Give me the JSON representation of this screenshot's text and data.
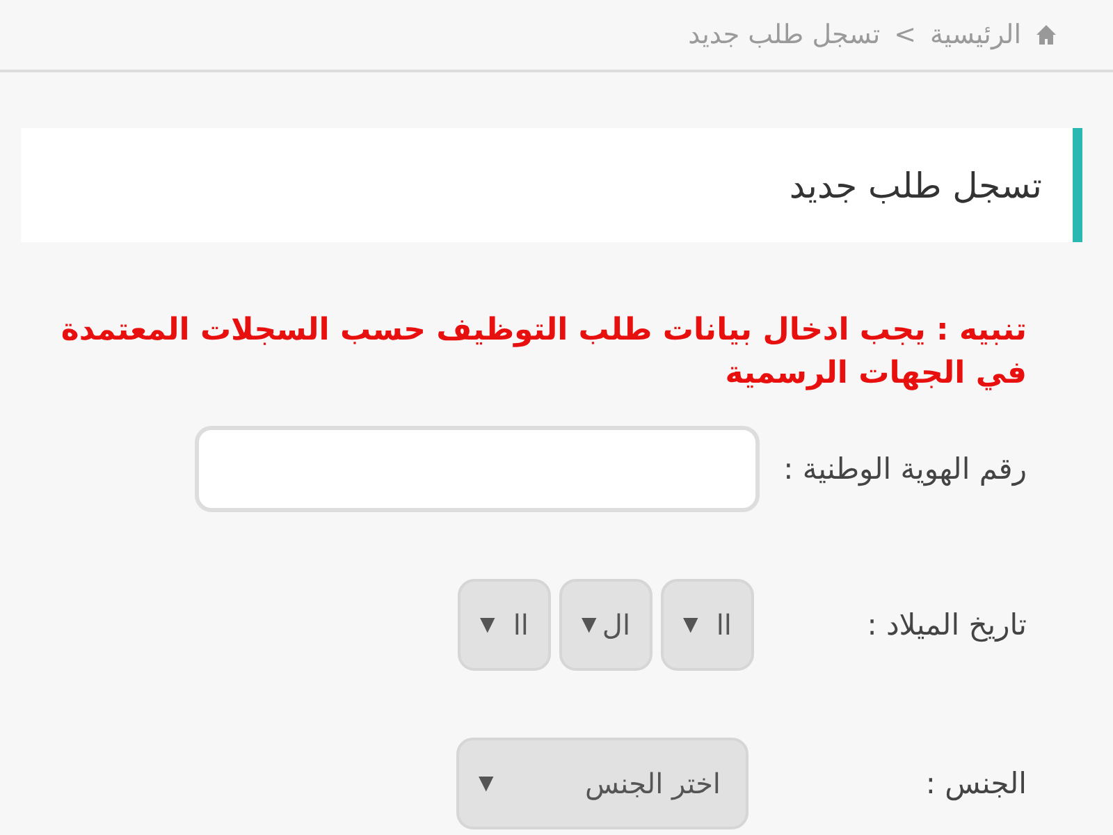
{
  "breadcrumb": {
    "home": "الرئيسية",
    "separator": ">",
    "current": "تسجل طلب جديد"
  },
  "page_title": "تسجل طلب جديد",
  "warning": "تنبيه : يجب ادخال بيانات طلب التوظيف حسب السجلات المعتمدة في الجهات الرسمية",
  "fields": [
    {
      "kind": "text",
      "label": "رقم الهوية الوطنية :"
    },
    {
      "kind": "date",
      "label": "تاريخ الميلاد :",
      "selects": [
        {
          "value": "اا",
          "arrow": "▼"
        },
        {
          "value": "ال",
          "arrow": "▼"
        },
        {
          "value": "اا",
          "arrow": "▼"
        }
      ]
    },
    {
      "kind": "select",
      "label": "الجنس :",
      "value": "اختر الجنس",
      "arrow": "▼"
    }
  ]
}
